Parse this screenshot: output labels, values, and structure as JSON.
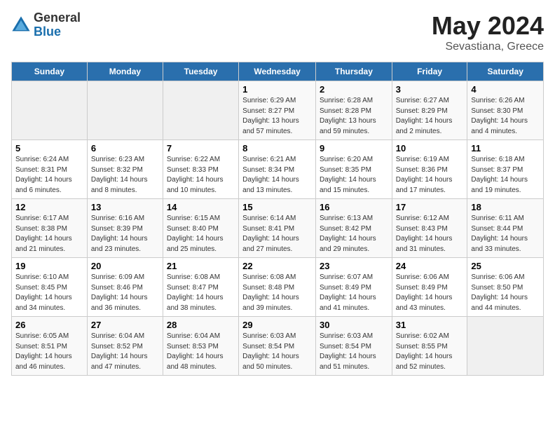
{
  "logo": {
    "general": "General",
    "blue": "Blue"
  },
  "title": "May 2024",
  "subtitle": "Sevastiana, Greece",
  "days_header": [
    "Sunday",
    "Monday",
    "Tuesday",
    "Wednesday",
    "Thursday",
    "Friday",
    "Saturday"
  ],
  "weeks": [
    [
      {
        "num": "",
        "info": ""
      },
      {
        "num": "",
        "info": ""
      },
      {
        "num": "",
        "info": ""
      },
      {
        "num": "1",
        "info": "Sunrise: 6:29 AM\nSunset: 8:27 PM\nDaylight: 13 hours and 57 minutes."
      },
      {
        "num": "2",
        "info": "Sunrise: 6:28 AM\nSunset: 8:28 PM\nDaylight: 13 hours and 59 minutes."
      },
      {
        "num": "3",
        "info": "Sunrise: 6:27 AM\nSunset: 8:29 PM\nDaylight: 14 hours and 2 minutes."
      },
      {
        "num": "4",
        "info": "Sunrise: 6:26 AM\nSunset: 8:30 PM\nDaylight: 14 hours and 4 minutes."
      }
    ],
    [
      {
        "num": "5",
        "info": "Sunrise: 6:24 AM\nSunset: 8:31 PM\nDaylight: 14 hours and 6 minutes."
      },
      {
        "num": "6",
        "info": "Sunrise: 6:23 AM\nSunset: 8:32 PM\nDaylight: 14 hours and 8 minutes."
      },
      {
        "num": "7",
        "info": "Sunrise: 6:22 AM\nSunset: 8:33 PM\nDaylight: 14 hours and 10 minutes."
      },
      {
        "num": "8",
        "info": "Sunrise: 6:21 AM\nSunset: 8:34 PM\nDaylight: 14 hours and 13 minutes."
      },
      {
        "num": "9",
        "info": "Sunrise: 6:20 AM\nSunset: 8:35 PM\nDaylight: 14 hours and 15 minutes."
      },
      {
        "num": "10",
        "info": "Sunrise: 6:19 AM\nSunset: 8:36 PM\nDaylight: 14 hours and 17 minutes."
      },
      {
        "num": "11",
        "info": "Sunrise: 6:18 AM\nSunset: 8:37 PM\nDaylight: 14 hours and 19 minutes."
      }
    ],
    [
      {
        "num": "12",
        "info": "Sunrise: 6:17 AM\nSunset: 8:38 PM\nDaylight: 14 hours and 21 minutes."
      },
      {
        "num": "13",
        "info": "Sunrise: 6:16 AM\nSunset: 8:39 PM\nDaylight: 14 hours and 23 minutes."
      },
      {
        "num": "14",
        "info": "Sunrise: 6:15 AM\nSunset: 8:40 PM\nDaylight: 14 hours and 25 minutes."
      },
      {
        "num": "15",
        "info": "Sunrise: 6:14 AM\nSunset: 8:41 PM\nDaylight: 14 hours and 27 minutes."
      },
      {
        "num": "16",
        "info": "Sunrise: 6:13 AM\nSunset: 8:42 PM\nDaylight: 14 hours and 29 minutes."
      },
      {
        "num": "17",
        "info": "Sunrise: 6:12 AM\nSunset: 8:43 PM\nDaylight: 14 hours and 31 minutes."
      },
      {
        "num": "18",
        "info": "Sunrise: 6:11 AM\nSunset: 8:44 PM\nDaylight: 14 hours and 33 minutes."
      }
    ],
    [
      {
        "num": "19",
        "info": "Sunrise: 6:10 AM\nSunset: 8:45 PM\nDaylight: 14 hours and 34 minutes."
      },
      {
        "num": "20",
        "info": "Sunrise: 6:09 AM\nSunset: 8:46 PM\nDaylight: 14 hours and 36 minutes."
      },
      {
        "num": "21",
        "info": "Sunrise: 6:08 AM\nSunset: 8:47 PM\nDaylight: 14 hours and 38 minutes."
      },
      {
        "num": "22",
        "info": "Sunrise: 6:08 AM\nSunset: 8:48 PM\nDaylight: 14 hours and 39 minutes."
      },
      {
        "num": "23",
        "info": "Sunrise: 6:07 AM\nSunset: 8:49 PM\nDaylight: 14 hours and 41 minutes."
      },
      {
        "num": "24",
        "info": "Sunrise: 6:06 AM\nSunset: 8:49 PM\nDaylight: 14 hours and 43 minutes."
      },
      {
        "num": "25",
        "info": "Sunrise: 6:06 AM\nSunset: 8:50 PM\nDaylight: 14 hours and 44 minutes."
      }
    ],
    [
      {
        "num": "26",
        "info": "Sunrise: 6:05 AM\nSunset: 8:51 PM\nDaylight: 14 hours and 46 minutes."
      },
      {
        "num": "27",
        "info": "Sunrise: 6:04 AM\nSunset: 8:52 PM\nDaylight: 14 hours and 47 minutes."
      },
      {
        "num": "28",
        "info": "Sunrise: 6:04 AM\nSunset: 8:53 PM\nDaylight: 14 hours and 48 minutes."
      },
      {
        "num": "29",
        "info": "Sunrise: 6:03 AM\nSunset: 8:54 PM\nDaylight: 14 hours and 50 minutes."
      },
      {
        "num": "30",
        "info": "Sunrise: 6:03 AM\nSunset: 8:54 PM\nDaylight: 14 hours and 51 minutes."
      },
      {
        "num": "31",
        "info": "Sunrise: 6:02 AM\nSunset: 8:55 PM\nDaylight: 14 hours and 52 minutes."
      },
      {
        "num": "",
        "info": ""
      }
    ]
  ]
}
